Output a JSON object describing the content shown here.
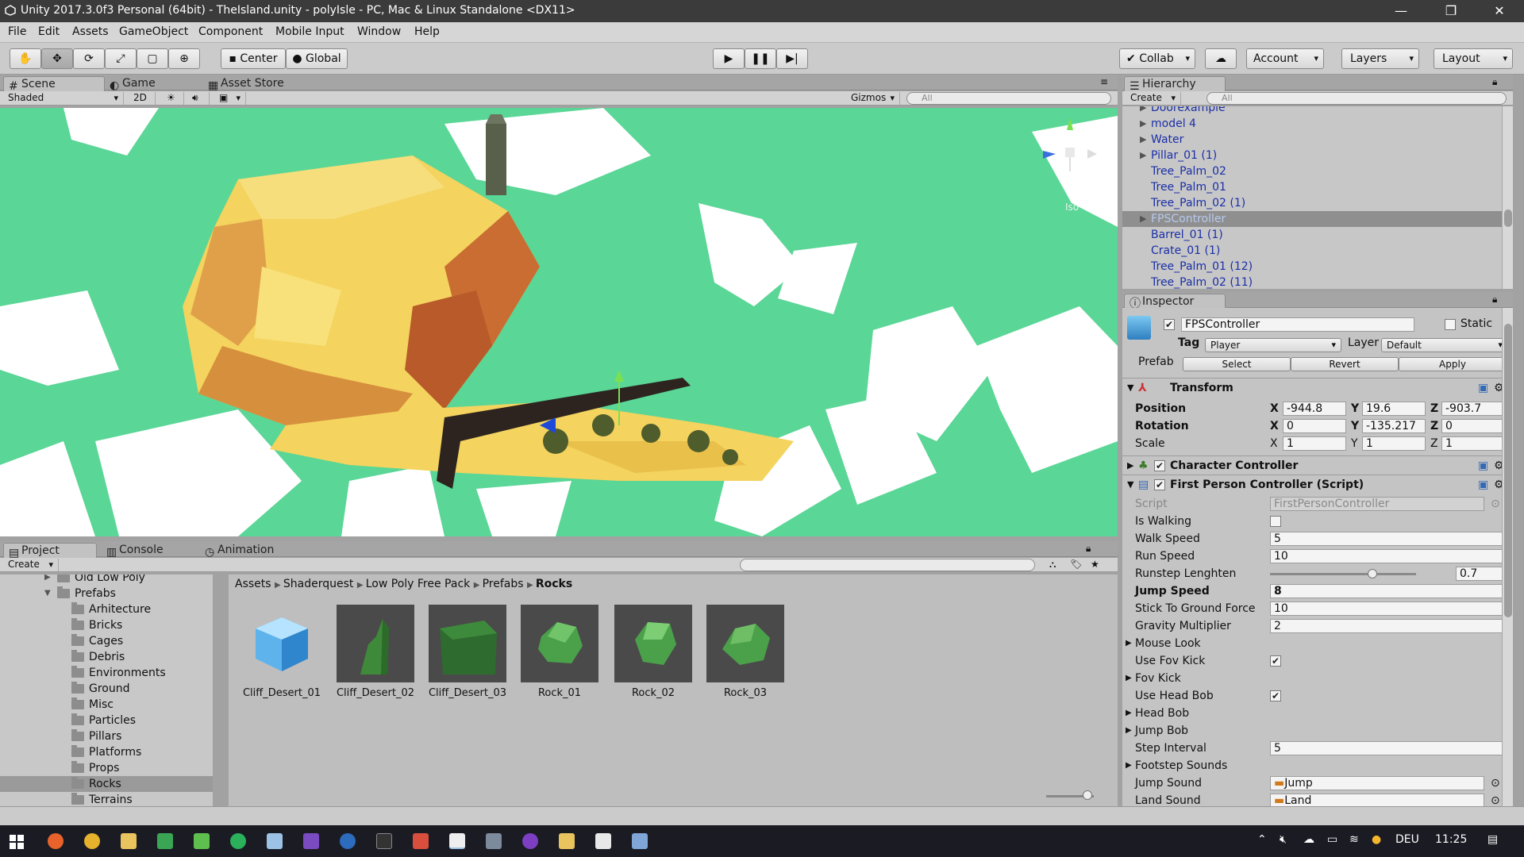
{
  "window": {
    "title": "Unity 2017.3.0f3 Personal (64bit) - TheIsland.unity - polyIsle - PC, Mac & Linux Standalone <DX11>",
    "minimize": "—",
    "restore": "❐",
    "close": "✕"
  },
  "menu": [
    "File",
    "Edit",
    "Assets",
    "GameObject",
    "Component",
    "Mobile Input",
    "Window",
    "Help"
  ],
  "toolbar": {
    "pivot": "Center",
    "space": "Global",
    "collab": "Collab",
    "account": "Account",
    "layers": "Layers",
    "layout": "Layout"
  },
  "scene_tabs": [
    "Scene",
    "Game",
    "Asset Store"
  ],
  "scene_bar": {
    "shading": "Shaded",
    "mode2d": "2D",
    "gizmos": "Gizmos",
    "search_placeholder": "All",
    "projection": "Iso"
  },
  "hierarchy": {
    "tab": "Hierarchy",
    "create": "Create",
    "search_placeholder": "All",
    "items": [
      {
        "label": "Doorexample",
        "arrow": "▶"
      },
      {
        "label": "model 4",
        "arrow": "▶"
      },
      {
        "label": "Water",
        "arrow": "▶"
      },
      {
        "label": "Pillar_01 (1)",
        "arrow": "▶"
      },
      {
        "label": "Tree_Palm_02",
        "arrow": ""
      },
      {
        "label": "Tree_Palm_01",
        "arrow": ""
      },
      {
        "label": "Tree_Palm_02 (1)",
        "arrow": ""
      },
      {
        "label": "FPSController",
        "arrow": "▶",
        "selected": true
      },
      {
        "label": "Barrel_01 (1)",
        "arrow": ""
      },
      {
        "label": "Crate_01 (1)",
        "arrow": ""
      },
      {
        "label": "Tree_Palm_01 (12)",
        "arrow": ""
      },
      {
        "label": "Tree_Palm_02 (11)",
        "arrow": ""
      }
    ]
  },
  "inspector": {
    "tab": "Inspector",
    "object_name": "FPSController",
    "static_label": "Static",
    "tag_label": "Tag",
    "tag_value": "Player",
    "layer_label": "Layer",
    "layer_value": "Default",
    "prefab_label": "Prefab",
    "prefab_select": "Select",
    "prefab_revert": "Revert",
    "prefab_apply": "Apply",
    "transform": {
      "title": "Transform",
      "position_label": "Position",
      "rotation_label": "Rotation",
      "scale_label": "Scale",
      "position": {
        "x": "-944.8",
        "y": "19.6",
        "z": "-903.7"
      },
      "rotation": {
        "x": "0",
        "y": "-135.217",
        "z": "0"
      },
      "scale": {
        "x": "1",
        "y": "1",
        "z": "1"
      }
    },
    "character_controller": "Character Controller",
    "fpc": {
      "title": "First Person Controller (Script)",
      "script_label": "Script",
      "script_value": "FirstPersonController",
      "is_walking": "Is Walking",
      "walk_speed_label": "Walk Speed",
      "walk_speed": "5",
      "run_speed_label": "Run Speed",
      "run_speed": "10",
      "runstep_label": "Runstep Lenghten",
      "runstep": "0.7",
      "runstep_fraction": 0.7,
      "jump_speed_label": "Jump Speed",
      "jump_speed": "8",
      "stick_label": "Stick To Ground Force",
      "stick": "10",
      "gravity_label": "Gravity Multiplier",
      "gravity": "2",
      "mouse_look": "Mouse Look",
      "use_fov_kick": "Use Fov Kick",
      "fov_kick": "Fov Kick",
      "use_head_bob": "Use Head Bob",
      "head_bob": "Head Bob",
      "jump_bob": "Jump Bob",
      "step_interval_label": "Step Interval",
      "step_interval": "5",
      "footstep_sounds": "Footstep Sounds",
      "jump_sound_label": "Jump Sound",
      "jump_sound": "Jump",
      "land_sound_label": "Land Sound",
      "land_sound": "Land"
    }
  },
  "bottom_tabs": [
    "Project",
    "Console",
    "Animation"
  ],
  "project": {
    "create": "Create",
    "tree": [
      {
        "label": "Old Low Poly",
        "arrow": "▶"
      },
      {
        "label": "Prefabs",
        "arrow": "▼"
      },
      {
        "label": "Arhitecture",
        "arrow": ""
      },
      {
        "label": "Bricks",
        "arrow": ""
      },
      {
        "label": "Cages",
        "arrow": ""
      },
      {
        "label": "Debris",
        "arrow": ""
      },
      {
        "label": "Environments",
        "arrow": ""
      },
      {
        "label": "Ground",
        "arrow": ""
      },
      {
        "label": "Misc",
        "arrow": ""
      },
      {
        "label": "Particles",
        "arrow": ""
      },
      {
        "label": "Pillars",
        "arrow": ""
      },
      {
        "label": "Platforms",
        "arrow": ""
      },
      {
        "label": "Props",
        "arrow": ""
      },
      {
        "label": "Rocks",
        "arrow": "",
        "selected": true
      },
      {
        "label": "Terrains",
        "arrow": ""
      }
    ],
    "breadcrumb": [
      "Assets",
      "Shaderquest",
      "Low Poly Free Pack",
      "Prefabs",
      "Rocks"
    ],
    "assets": [
      "Cliff_Desert_01",
      "Cliff_Desert_02",
      "Cliff_Desert_03",
      "Rock_01",
      "Rock_02",
      "Rock_03"
    ]
  },
  "taskbar": {
    "language": "DEU",
    "time": "11:25"
  },
  "colors": {
    "scene_bg": "#5ad696",
    "island": "#f4d35e",
    "hierarchy_text": "#1b2fa6"
  }
}
